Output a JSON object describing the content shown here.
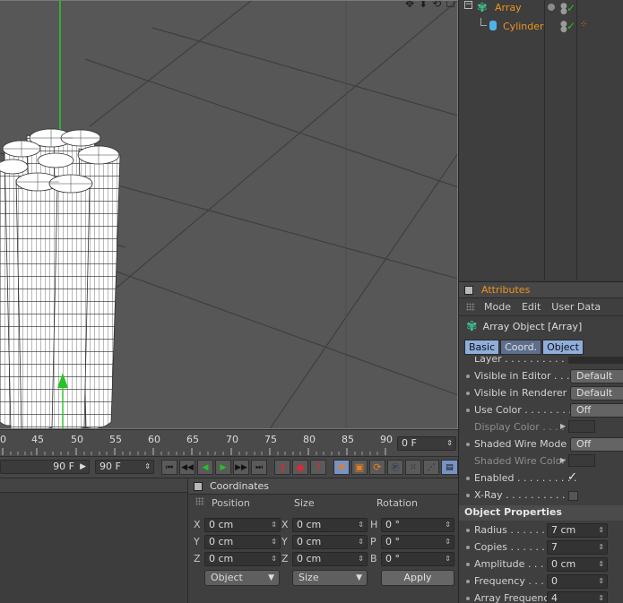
{
  "viewport": {
    "icons": [
      "move-icon",
      "down-arrow-icon",
      "rotate-icon",
      "maximize-icon"
    ]
  },
  "timeline": {
    "ticks": [
      "0",
      "45",
      "50",
      "55",
      "60",
      "65",
      "70",
      "75",
      "80",
      "85",
      "90"
    ],
    "current_frame": "0 F"
  },
  "transport": {
    "end_frame_left": "90 F",
    "end_frame_right": "90 F"
  },
  "coordinates": {
    "title": "Coordinates",
    "col_position": "Position",
    "col_size": "Size",
    "col_rotation": "Rotation",
    "rows": [
      {
        "axis": "X",
        "pos": "0 cm",
        "size_axis": "X",
        "size": "0 cm",
        "rot_axis": "H",
        "rot": "0 °"
      },
      {
        "axis": "Y",
        "pos": "0 cm",
        "size_axis": "Y",
        "size": "0 cm",
        "rot_axis": "P",
        "rot": "0 °"
      },
      {
        "axis": "Z",
        "pos": "0 cm",
        "size_axis": "Z",
        "size": "0 cm",
        "rot_axis": "B",
        "rot": "0 °"
      }
    ],
    "mode_select": "Object",
    "size_select": "Size",
    "apply_label": "Apply"
  },
  "object_manager": {
    "items": [
      {
        "name": "Array",
        "indent": 0
      },
      {
        "name": "Cylinder",
        "indent": 1
      }
    ]
  },
  "attributes": {
    "title": "Attributes",
    "menu": [
      "Mode",
      "Edit",
      "User Data"
    ],
    "object_title": "Array Object [Array]",
    "tabs": [
      "Basic",
      "Coord.",
      "Object"
    ],
    "basic": {
      "layer_label": "Layer . . . . . . . . . . . .",
      "visible_editor_label": "Visible in Editor . . . . .",
      "visible_editor_value": "Default",
      "visible_renderer_label": "Visible in Renderer . .",
      "visible_renderer_value": "Default",
      "use_color_label": "Use Color . . . . . . . . . .",
      "use_color_value": "Off",
      "display_color_label": "Display Color . . . .",
      "shaded_wire_mode_label": "Shaded Wire Mode",
      "shaded_wire_mode_value": "Off",
      "shaded_wire_color_label": "Shaded Wire Color",
      "enabled_label": "Enabled . . . . . . . . . .",
      "enabled_value": "✓",
      "xray_label": "X-Ray . . . . . . . . . . . ."
    },
    "object_properties_title": "Object Properties",
    "object_properties": [
      {
        "label": "Radius . . . . . . .",
        "value": "7 cm"
      },
      {
        "label": "Copies . . . . . . .",
        "value": "7"
      },
      {
        "label": "Amplitude . . . . .",
        "value": "0 cm"
      },
      {
        "label": "Frequency . . . .",
        "value": "0"
      },
      {
        "label": "Array Frequency",
        "value": "4"
      }
    ]
  },
  "colors": {
    "accent_orange": "#f0931c",
    "check_green": "#27c127",
    "tab_blue": "#8faedc",
    "viewport_bg": "#575757"
  }
}
